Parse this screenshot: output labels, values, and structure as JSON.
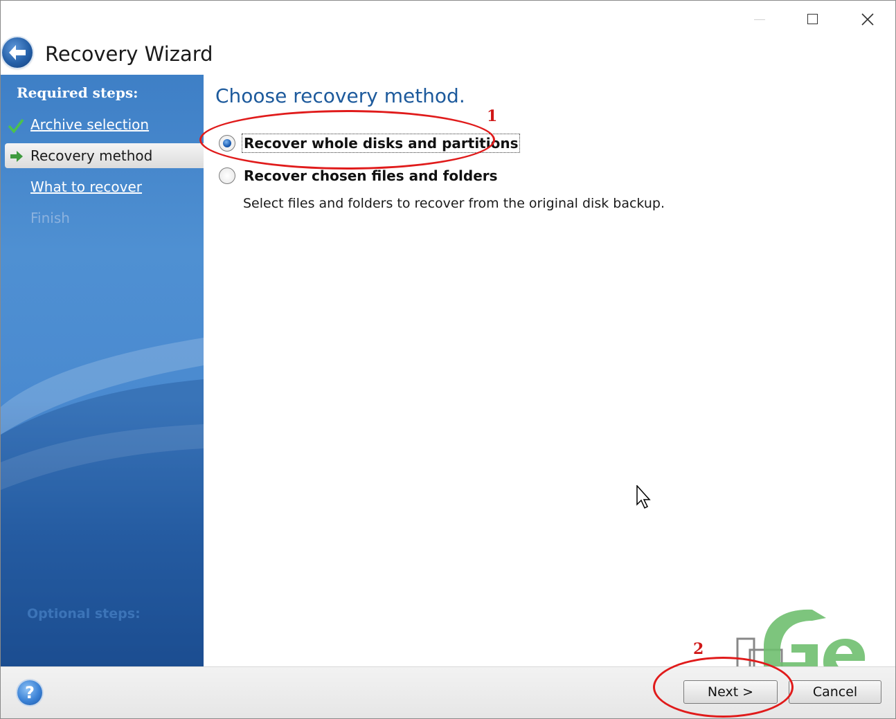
{
  "window": {
    "title": "Recovery Wizard"
  },
  "sidebar": {
    "heading": "Required steps:",
    "items": [
      {
        "label": "Archive selection",
        "state": "completed"
      },
      {
        "label": "Recovery method",
        "state": "active"
      },
      {
        "label": "What to recover",
        "state": "link"
      },
      {
        "label": "Finish",
        "state": "disabled"
      }
    ],
    "optional_heading": "Optional steps:"
  },
  "main": {
    "heading": "Choose recovery method.",
    "options": [
      {
        "label": "Recover whole disks and partitions",
        "selected": true
      },
      {
        "label": "Recover chosen files and folders",
        "selected": false
      }
    ],
    "description": "Select files and folders to recover from the original disk backup."
  },
  "footer": {
    "help_icon_text": "?",
    "next_label": "Next >",
    "cancel_label": "Cancel"
  },
  "annotations": {
    "marker_1": "1",
    "marker_2": "2",
    "color": "#e01b1b"
  },
  "colors": {
    "heading": "#1d5a9c",
    "sidebar": "#4f90d2"
  }
}
